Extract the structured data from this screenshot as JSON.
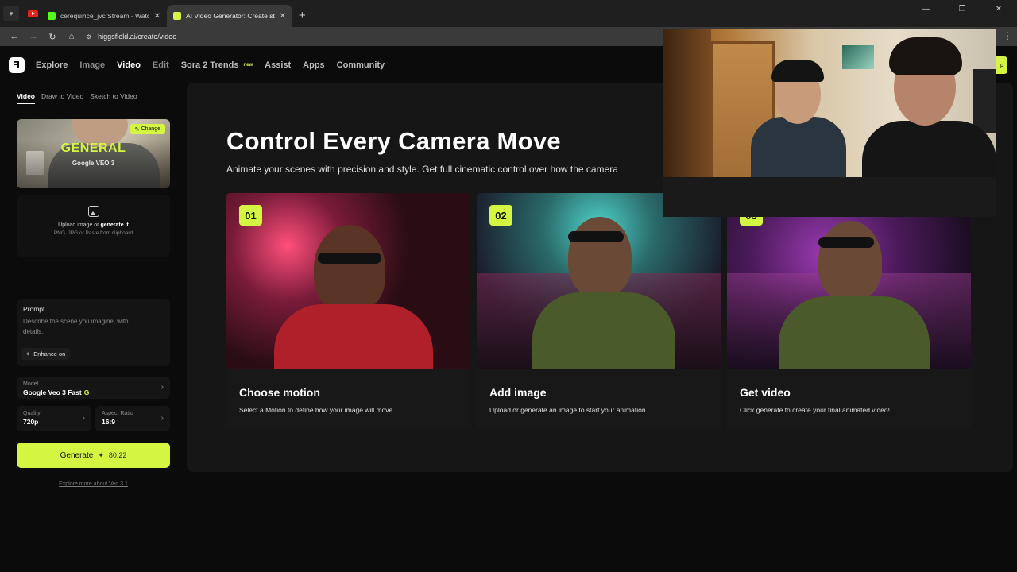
{
  "browser": {
    "tabs": [
      {
        "title": "cerequince_jvc Stream - Watch",
        "fav_color": "#53fc18",
        "active": false
      },
      {
        "title": "AI Video Generator: Create stu",
        "fav_color": "#d4f542",
        "active": true
      }
    ],
    "url": "higgsfield.ai/create/video"
  },
  "nav": {
    "items": [
      "Explore",
      "Image",
      "Video",
      "Edit",
      "Sora 2 Trends",
      "Assist",
      "Apps",
      "Community"
    ],
    "new_badge": "new"
  },
  "sidebar": {
    "subtabs": [
      "Video",
      "Draw to Video",
      "Sketch to Video"
    ],
    "preset": {
      "title": "GENERAL",
      "subtitle": "Google VEO 3",
      "change_label": "Change"
    },
    "upload": {
      "line1_prefix": "Upload image or ",
      "line1_link": "generate it",
      "line2": "PNG, JPG or Paste from clipboard"
    },
    "prompt": {
      "label": "Prompt",
      "placeholder": "Describe the scene you imagine, with details.",
      "enhance": "Enhance on"
    },
    "model": {
      "label": "Model",
      "value": "Google Veo 3 Fast",
      "badge": "G"
    },
    "quality": {
      "label": "Quality",
      "value": "720p"
    },
    "aspect": {
      "label": "Aspect Ratio",
      "value": "16:9"
    },
    "generate": {
      "label": "Generate",
      "credits": "80.22"
    },
    "explore_link": "Explore more about Veo 3.1"
  },
  "main": {
    "title": "Control Every Camera Move",
    "subtitle": "Animate your scenes with precision and style. Get full cinematic control over how the camera",
    "steps": [
      {
        "num": "01",
        "title": "Choose motion",
        "desc": "Select a Motion to define how your image will move"
      },
      {
        "num": "02",
        "title": "Add image",
        "desc": "Upload or generate an image to start your animation"
      },
      {
        "num": "03",
        "title": "Get video",
        "desc": "Click generate to create your final animated video!"
      }
    ]
  },
  "colors": {
    "accent": "#d4f542"
  }
}
